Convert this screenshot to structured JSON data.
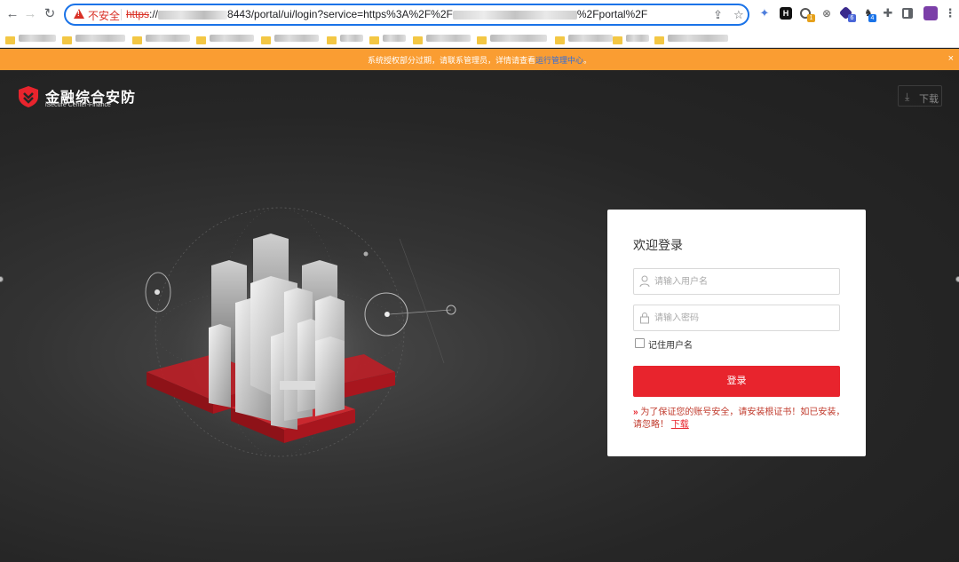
{
  "browser": {
    "back_icon": "←",
    "forward_icon": "→",
    "reload_icon": "↻",
    "security_label": "不安全",
    "url_scheme": "https",
    "url_prefix": "://",
    "url_port_path": "8443/portal/ui/login?service=https%3A%2F%2F",
    "url_suffix": "%2Fportal%2F",
    "extension_badges": [
      "1",
      "6",
      "4"
    ],
    "extension_letter": "H"
  },
  "banner": {
    "text": "系统授权部分过期，请联系管理员，详情请查看",
    "link": "运行管理中心",
    "tail": "。",
    "close": "×"
  },
  "header": {
    "title": "金融综合安防",
    "subtitle": "iSecure Center-Finance",
    "download_label": "下载"
  },
  "login": {
    "welcome": "欢迎登录",
    "username_placeholder": "请输入用户名",
    "password_placeholder": "请输入密码",
    "remember_label": "记住用户名",
    "login_button": "登录",
    "notice_arrow": "»",
    "notice_text": "为了保证您的账号安全，请安装根证书！如已安装，请忽略！",
    "notice_link": "下载"
  },
  "colors": {
    "accent_red": "#e8242d",
    "banner_orange": "#fa9d32",
    "background_dark": "#262626"
  }
}
